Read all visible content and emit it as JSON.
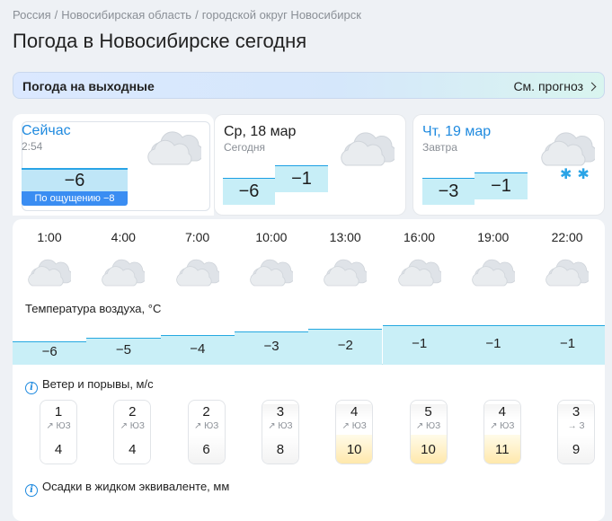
{
  "breadcrumb": [
    "Россия",
    "Новосибирская область",
    "городской округ Новосибирск"
  ],
  "title": "Погода в Новосибирске сегодня",
  "weekend": {
    "title": "Погода на выходные",
    "link": "См. прогноз"
  },
  "now": {
    "title": "Сейчас",
    "time": "2:54",
    "temp": "−6",
    "feels": "По ощущению −8",
    "icon": "cloud-icon"
  },
  "today": {
    "title": "Ср, 18 мар",
    "sub": "Сегодня",
    "night": "−6",
    "day": "−1",
    "icon": "cloud-icon"
  },
  "tomorrow": {
    "title": "Чт, 19 мар",
    "sub": "Завтра",
    "night": "−3",
    "day": "−1",
    "icon": "snow-cloud-icon"
  },
  "hourly": {
    "hours": [
      "1:00",
      "4:00",
      "7:00",
      "10:00",
      "13:00",
      "16:00",
      "19:00",
      "22:00"
    ],
    "icons": [
      "cloud-icon",
      "cloud-icon",
      "cloud-icon",
      "cloud-icon",
      "cloud-icon",
      "cloud-icon",
      "cloud-icon",
      "cloud-icon"
    ],
    "temp_label": "Температура воздуха, °C",
    "temps": [
      "−6",
      "−5",
      "−4",
      "−3",
      "−2",
      "−1",
      "−1",
      "−1"
    ],
    "temp_values": [
      -6,
      -5,
      -4,
      -3,
      -2,
      -1,
      -1,
      -1
    ],
    "wind_label": "Ветер и порывы, м/с",
    "wind": [
      {
        "speed": "1",
        "dir": "↗ ЮЗ",
        "gust": "4"
      },
      {
        "speed": "2",
        "dir": "↗ ЮЗ",
        "gust": "4"
      },
      {
        "speed": "2",
        "dir": "↗ ЮЗ",
        "gust": "6"
      },
      {
        "speed": "3",
        "dir": "↗ ЮЗ",
        "gust": "8"
      },
      {
        "speed": "4",
        "dir": "↗ ЮЗ",
        "gust": "10"
      },
      {
        "speed": "5",
        "dir": "↗ ЮЗ",
        "gust": "10"
      },
      {
        "speed": "4",
        "dir": "↗ ЮЗ",
        "gust": "11"
      },
      {
        "speed": "3",
        "dir": "→ З",
        "gust": "9"
      }
    ],
    "precip_label": "Осадки в жидком эквиваленте, мм"
  },
  "colors": {
    "accent": "#1f8adf",
    "bar_fill": "#c7eef7",
    "bar_line": "#1b9fe4",
    "feels_bg": "#3a8df2",
    "gust_high": "#ffe7a8"
  }
}
